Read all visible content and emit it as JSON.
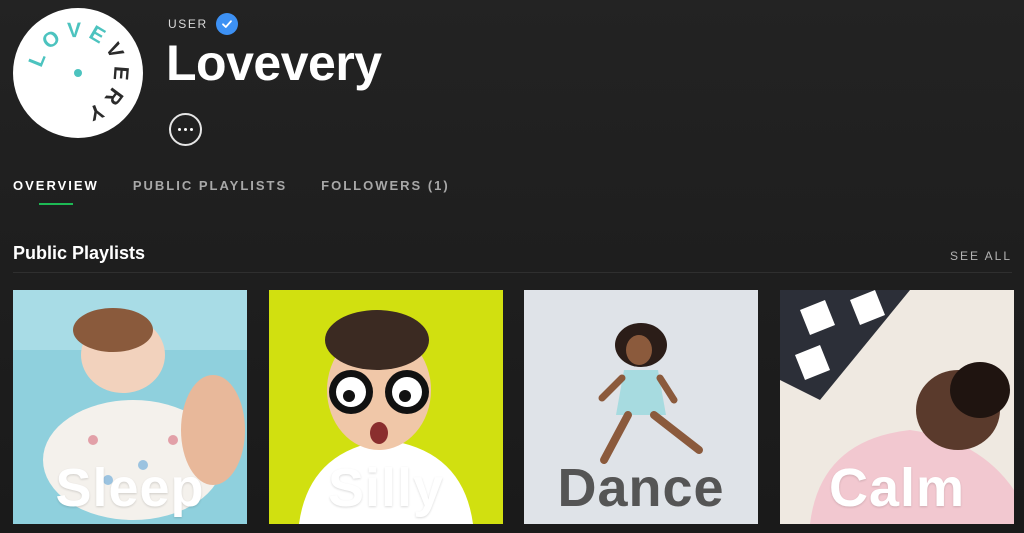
{
  "header": {
    "type_label": "USER",
    "name": "Lovevery",
    "avatar_logo_text": "LOVEVERY",
    "verified_icon": "check-badge",
    "more_icon": "ellipsis"
  },
  "tabs": [
    {
      "label": "OVERVIEW",
      "active": true
    },
    {
      "label": "PUBLIC PLAYLISTS",
      "active": false
    },
    {
      "label": "FOLLOWERS (1)",
      "active": false
    }
  ],
  "section": {
    "title": "Public Playlists",
    "see_all": "SEE ALL"
  },
  "playlists": [
    {
      "title": "Sleep",
      "color": "#8fd0dd"
    },
    {
      "title": "Silly",
      "color": "#d1e010"
    },
    {
      "title": "Dance",
      "color": "#dfe3e8"
    },
    {
      "title": "Calm",
      "color": "#efe9e1"
    }
  ],
  "colors": {
    "accent": "#1db954",
    "verified": "#3d91f4",
    "background": "#1f1f1f"
  }
}
